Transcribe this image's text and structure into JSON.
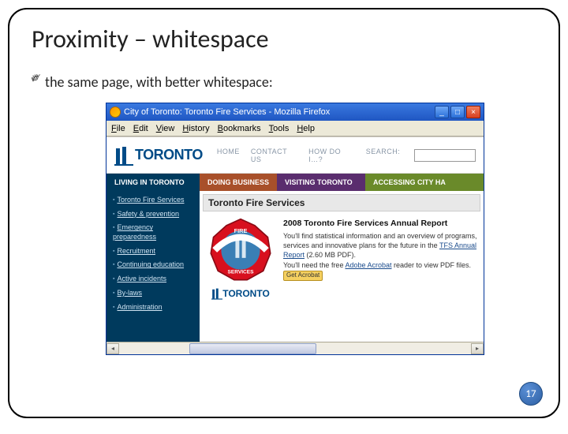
{
  "slide": {
    "title": "Proximity – whitespace",
    "bullet": "the same page, with better whitespace:",
    "page_number": "17"
  },
  "browser": {
    "window_title": "City of Toronto: Toronto Fire Services - Mozilla Firefox",
    "menu": {
      "file": "File",
      "edit": "Edit",
      "view": "View",
      "history": "History",
      "bookmarks": "Bookmarks",
      "tools": "Tools",
      "help": "Help"
    },
    "win_buttons": {
      "min": "_",
      "max": "□",
      "close": "×"
    }
  },
  "header": {
    "logo_text": "TORONTO",
    "nav": {
      "home": "HOME",
      "contact": "CONTACT US",
      "howdo": "HOW DO I…?",
      "search_label": "SEARCH:"
    }
  },
  "tabs": {
    "living": "LIVING IN TORONTO",
    "doing": "DOING BUSINESS",
    "visiting": "VISITING TORONTO",
    "accessing": "ACCESSING CITY HA"
  },
  "sidebar": {
    "items": [
      "Toronto Fire Services",
      "Safety & prevention",
      "Emergency preparedness",
      "Recruitment",
      "Continuing education",
      "Active incidents",
      "By-laws",
      "Administration"
    ]
  },
  "page": {
    "title": "Toronto Fire Services",
    "article_title": "2008 Toronto Fire Services Annual Report",
    "body_pre": "You'll find statistical information and an overview of programs, services and innovative plans for the future in the ",
    "link_text": "TFS Annual Report",
    "pdf_size": " (2.60 MB PDF).",
    "body2_pre": "You'll need the free ",
    "body2_post": " reader to view PDF files. ",
    "acrobat_link": "Adobe Acrobat",
    "acrobat_btn": "Get Acrobat",
    "mini_logo": "TORONTO",
    "badge_top": "FIRE",
    "badge_bottom": "SERVICES"
  }
}
